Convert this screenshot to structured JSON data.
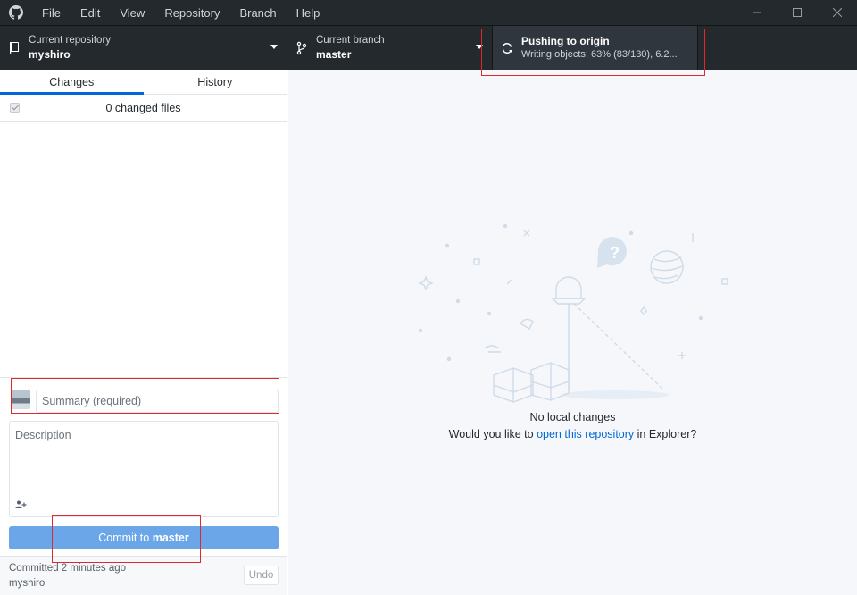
{
  "menu": [
    "File",
    "Edit",
    "View",
    "Repository",
    "Branch",
    "Help"
  ],
  "toolbar": {
    "repo_label": "Current repository",
    "repo_value": "myshiro",
    "branch_label": "Current branch",
    "branch_value": "master",
    "push_title": "Pushing to origin",
    "push_progress": "Writing objects: 63% (83/130), 6.2..."
  },
  "sidebar": {
    "tabs": [
      "Changes",
      "History"
    ],
    "changed_files": "0 changed files",
    "summary_placeholder": "Summary (required)",
    "description_placeholder": "Description",
    "commit_prefix": "Commit to ",
    "commit_branch": "master",
    "last_commit_time": "Committed 2 minutes ago",
    "last_commit_author": "myshiro",
    "undo": "Undo"
  },
  "main": {
    "title": "No local changes",
    "prompt_before": "Would you like to ",
    "prompt_link": "open this repository",
    "prompt_after": " in Explorer?"
  },
  "colors": {
    "titlebar": "#24292e",
    "accent": "#0366d6",
    "commit_button": "#6aa6e8",
    "highlight": "#e0292e"
  }
}
